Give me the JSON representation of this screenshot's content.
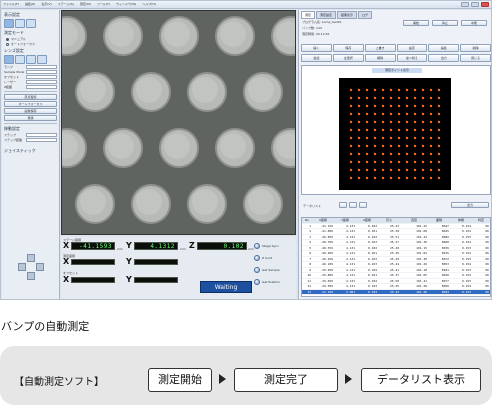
{
  "window": {
    "menu": [
      "ファイル(F)",
      "編集(E)",
      "表示(V)",
      "ステージ(S)",
      "測定(M)",
      "ツール(T)",
      "ウィンドウ(W)",
      "ヘルプ(H)"
    ]
  },
  "left_panel": {
    "section1": "表示設定",
    "section2": "測定モード",
    "radio1": "マニュアル",
    "radio2": "オートフォーカス",
    "section3": "レンズ設定",
    "field_labels": [
      "ステップ",
      "ステップ距離",
      "ランプ",
      "Sample Mode",
      "オフセット",
      "レーザー",
      "Z範囲"
    ],
    "buttons": [
      "原点復帰",
      "オートフォーカス",
      "画像保存",
      "登録"
    ],
    "section4": "移動設定",
    "jog_label": "ジョイスティック"
  },
  "coords": {
    "label_stage": "ステージ座標",
    "label_measure": "測定座標",
    "label_offset": "オフセット",
    "x_value": "-41.1593",
    "y_value": "4.1312",
    "z_value": "0.102",
    "unit": "mm",
    "status": "Waiting",
    "side_buttons": [
      "Stage Sync",
      "Z Cont",
      "Get Sample",
      "Get Position"
    ]
  },
  "right_panel": {
    "tabs": [
      "測定",
      "測定設定",
      "結果表示",
      "ログ"
    ],
    "info_lines": [
      "プログラム名: bump_test01",
      "バンプ数: 144",
      "測定時間: 00:12:45"
    ],
    "top_buttons": [
      "開始",
      "停止",
      "中断"
    ],
    "toolbar": [
      "開く",
      "保存",
      "上書き",
      "設定",
      "編集",
      "削除",
      "追加",
      "全選択",
      "解除",
      "並べ替え",
      "出力",
      "閉じる"
    ],
    "plot_title": "測定ポイント表示",
    "result_label": "データリスト"
  },
  "table": {
    "headers": [
      "No",
      "X座標",
      "Y座標",
      "Z座標",
      "高さ",
      "直径",
      "面積",
      "体積",
      "判定"
    ],
    "rows": [
      [
        "1",
        "-41.159",
        "4.131",
        "0.102",
        "25.43",
        "101.22",
        "8047",
        "0.154",
        "OK"
      ],
      [
        "2",
        "-41.009",
        "4.131",
        "0.101",
        "25.38",
        "101.08",
        "8025",
        "0.152",
        "OK"
      ],
      [
        "3",
        "-40.859",
        "4.131",
        "0.102",
        "25.51",
        "101.44",
        "8082",
        "0.155",
        "OK"
      ],
      [
        "4",
        "-40.709",
        "4.131",
        "0.103",
        "25.47",
        "101.30",
        "8060",
        "0.154",
        "OK"
      ],
      [
        "5",
        "-40.559",
        "4.131",
        "0.102",
        "25.40",
        "101.15",
        "8036",
        "0.153",
        "OK"
      ],
      [
        "6",
        "-40.409",
        "4.131",
        "0.101",
        "25.36",
        "101.02",
        "8015",
        "0.152",
        "OK"
      ],
      [
        "7",
        "-40.259",
        "4.131",
        "0.102",
        "25.49",
        "101.38",
        "8072",
        "0.155",
        "OK"
      ],
      [
        "8",
        "-40.109",
        "4.131",
        "0.103",
        "25.44",
        "101.26",
        "8053",
        "0.154",
        "OK"
      ],
      [
        "9",
        "-39.959",
        "4.131",
        "0.102",
        "25.41",
        "101.18",
        "8041",
        "0.153",
        "OK"
      ],
      [
        "10",
        "-39.809",
        "4.131",
        "0.101",
        "25.37",
        "101.05",
        "8020",
        "0.152",
        "OK"
      ],
      [
        "11",
        "-39.659",
        "4.131",
        "0.102",
        "25.50",
        "101.41",
        "8077",
        "0.155",
        "OK"
      ],
      [
        "12",
        "-39.509",
        "4.131",
        "0.103",
        "25.45",
        "101.28",
        "8056",
        "0.154",
        "OK"
      ],
      [
        "13",
        "-41.159",
        "3.981",
        "0.102",
        "25.42",
        "101.20",
        "8044",
        "0.153",
        "OK"
      ],
      [
        "14",
        "-41.009",
        "3.981",
        "0.101",
        "25.39",
        "101.10",
        "8028",
        "0.152",
        "OK"
      ],
      [
        "15",
        "-40.859",
        "3.981",
        "0.102",
        "25.52",
        "101.46",
        "8085",
        "0.155",
        "OK"
      ]
    ],
    "selected_row": 12
  },
  "caption": "バンプの自動測定",
  "flow": {
    "label": "【自動測定ソフト】",
    "steps": [
      "測定開始",
      "測定完了",
      "データリスト表示"
    ]
  }
}
